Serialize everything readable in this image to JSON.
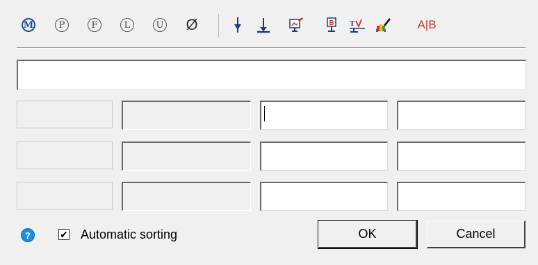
{
  "toolbar": {
    "symbols": [
      {
        "name": "m-icon",
        "glyph": "M",
        "active": true
      },
      {
        "name": "p-icon",
        "glyph": "P",
        "active": false
      },
      {
        "name": "f-icon",
        "glyph": "F",
        "active": false
      },
      {
        "name": "l-icon",
        "glyph": "L",
        "active": false
      },
      {
        "name": "u-icon",
        "glyph": "U",
        "active": false
      }
    ],
    "diameter_glyph": "Ø",
    "ab_text": "A|B"
  },
  "main_field": {
    "value": ""
  },
  "rows": [
    [
      "",
      "",
      "",
      ""
    ],
    [
      "",
      "",
      "",
      ""
    ],
    [
      "",
      "",
      "",
      ""
    ]
  ],
  "footer": {
    "help_glyph": "?",
    "checkbox_checked_glyph": "✔",
    "auto_sort_label": "Automatic sorting",
    "ok_label": "OK",
    "cancel_label": "Cancel"
  },
  "colors": {
    "accent": "#1a4fa0",
    "ab_red": "#c0392b"
  }
}
